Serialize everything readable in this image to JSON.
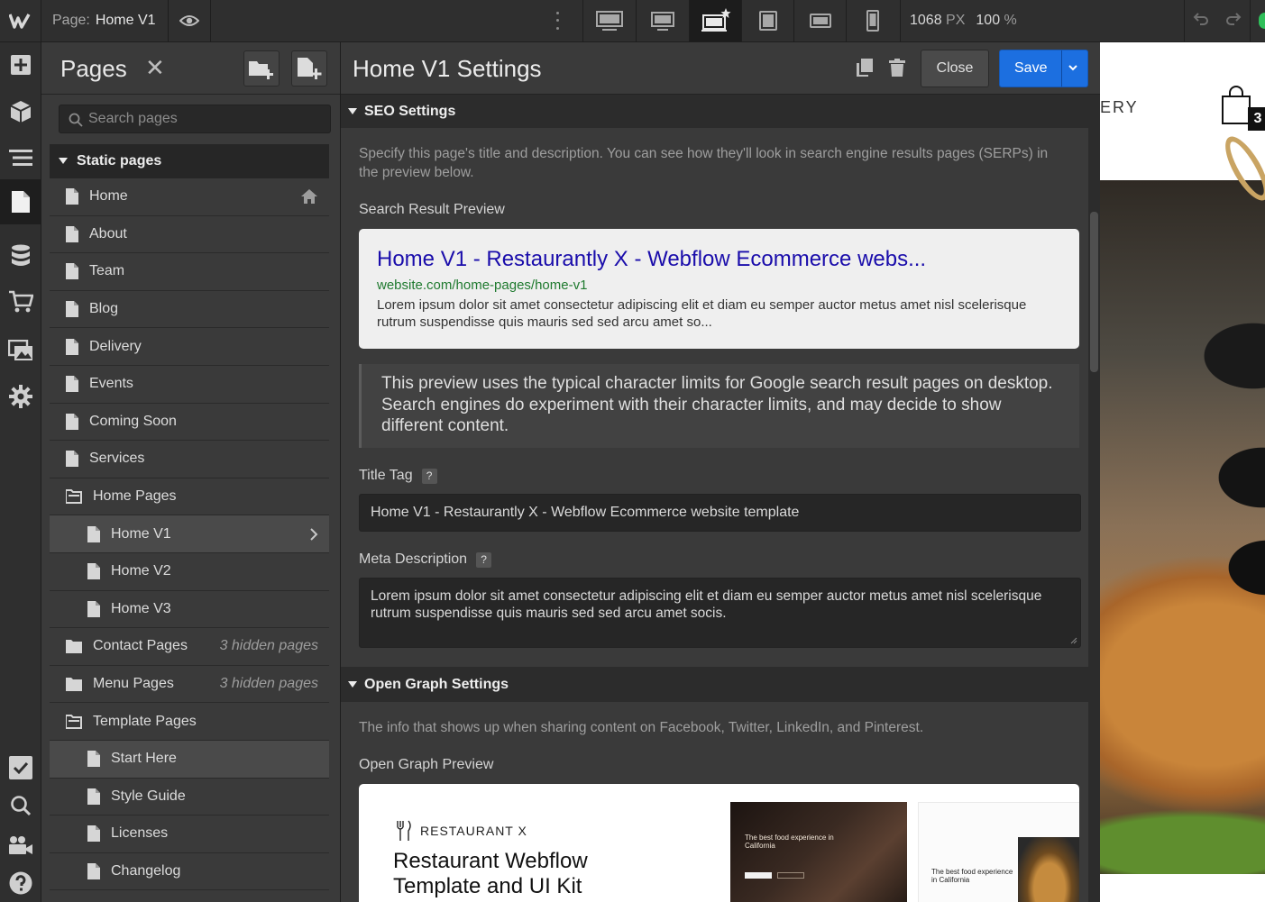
{
  "topbar": {
    "page_prefix": "Page:",
    "page_name": "Home V1",
    "width_value": "1068",
    "width_unit": "PX",
    "zoom_value": "100",
    "zoom_unit": "%"
  },
  "pages_panel": {
    "title": "Pages",
    "close_glyph": "✕",
    "search_placeholder": "Search pages",
    "group_label": "Static pages",
    "items": [
      {
        "label": "Home",
        "type": "page",
        "level": 0,
        "badge": "home-icon"
      },
      {
        "label": "About",
        "type": "page",
        "level": 0
      },
      {
        "label": "Team",
        "type": "page",
        "level": 0
      },
      {
        "label": "Blog",
        "type": "page",
        "level": 0
      },
      {
        "label": "Delivery",
        "type": "page",
        "level": 0
      },
      {
        "label": "Events",
        "type": "page",
        "level": 0
      },
      {
        "label": "Coming Soon",
        "type": "page",
        "level": 0
      },
      {
        "label": "Services",
        "type": "page",
        "level": 0
      },
      {
        "label": "Home Pages",
        "type": "folder-open",
        "level": 0
      },
      {
        "label": "Home V1",
        "type": "page",
        "level": 1,
        "selected": true
      },
      {
        "label": "Home V2",
        "type": "page",
        "level": 1
      },
      {
        "label": "Home V3",
        "type": "page",
        "level": 1
      },
      {
        "label": "Contact Pages",
        "type": "folder",
        "level": 0,
        "note": "3 hidden pages"
      },
      {
        "label": "Menu Pages",
        "type": "folder",
        "level": 0,
        "note": "3 hidden pages"
      },
      {
        "label": "Template Pages",
        "type": "folder-open",
        "level": 0
      },
      {
        "label": "Start Here",
        "type": "page",
        "level": 1,
        "highlight": true
      },
      {
        "label": "Style Guide",
        "type": "page",
        "level": 1
      },
      {
        "label": "Licenses",
        "type": "page",
        "level": 1
      },
      {
        "label": "Changelog",
        "type": "page",
        "level": 1
      }
    ]
  },
  "settings": {
    "title": "Home V1 Settings",
    "close_label": "Close",
    "save_label": "Save",
    "seo_header": "SEO Settings",
    "seo_desc": "Specify this page's title and description. You can see how they'll look in search engine results pages (SERPs) in the preview below.",
    "preview_label": "Search Result Preview",
    "preview_title": "Home V1 - Restaurantly X - Webflow Ecommerce webs...",
    "preview_url": "website.com/home-pages/home-v1",
    "preview_desc": "Lorem ipsum dolor sit amet consectetur adipiscing elit et diam eu semper auctor metus amet nisl scelerisque rutrum suspendisse quis mauris sed sed arcu amet so...",
    "note": "This preview uses the typical character limits for Google search result pages on desktop. Search engines do experiment with their character limits, and may decide to show different content.",
    "title_tag_label": "Title Tag",
    "title_tag_value": "Home V1 - Restaurantly X - Webflow Ecommerce website template",
    "meta_label": "Meta Description",
    "meta_value": "Lorem ipsum dolor sit amet consectetur adipiscing elit et diam eu semper auctor metus amet nisl scelerisque rutrum suspendisse quis mauris sed sed arcu amet socis.",
    "qmark": "?",
    "og_header": "Open Graph Settings",
    "og_desc": "The info that shows up when sharing content on Facebook, Twitter, LinkedIn, and Pinterest.",
    "og_preview_label": "Open Graph Preview",
    "og_brand": "RESTAURANT X",
    "og_headline": "Restaurant Webflow Template and UI Kit",
    "og_img_text": "The best food experience in California"
  },
  "canvas": {
    "nav_text": "ERY",
    "cart_count": "3"
  },
  "colors": {
    "accent": "#1c6fe0",
    "serp_title": "#1a0dab",
    "serp_url": "#1f7a2f"
  }
}
